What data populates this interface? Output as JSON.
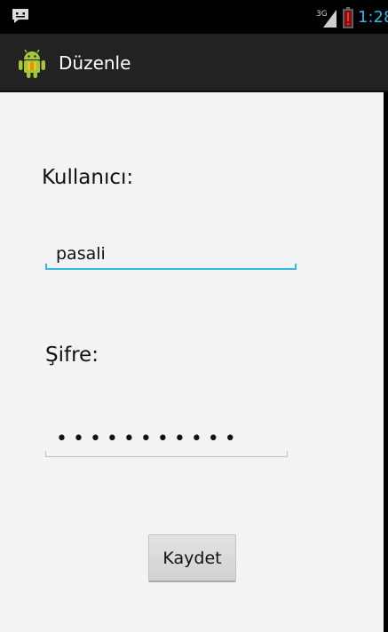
{
  "status_bar": {
    "network_type": "3G",
    "time": "1:28",
    "icons": [
      "message-notification-icon",
      "signal-icon",
      "battery-low-icon"
    ],
    "clock_color": "#33b5e5"
  },
  "action_bar": {
    "title": "Düzenle",
    "icon": "android-app-icon"
  },
  "form": {
    "username_label": "Kullanıcı:",
    "username_value": "pasali",
    "password_label": "Şifre:",
    "password_value": "•••••••••••",
    "save_label": "Kaydet"
  },
  "colors": {
    "accent": "#33b5e5",
    "action_bar_bg": "#222222",
    "content_bg": "#f3f3f3"
  }
}
